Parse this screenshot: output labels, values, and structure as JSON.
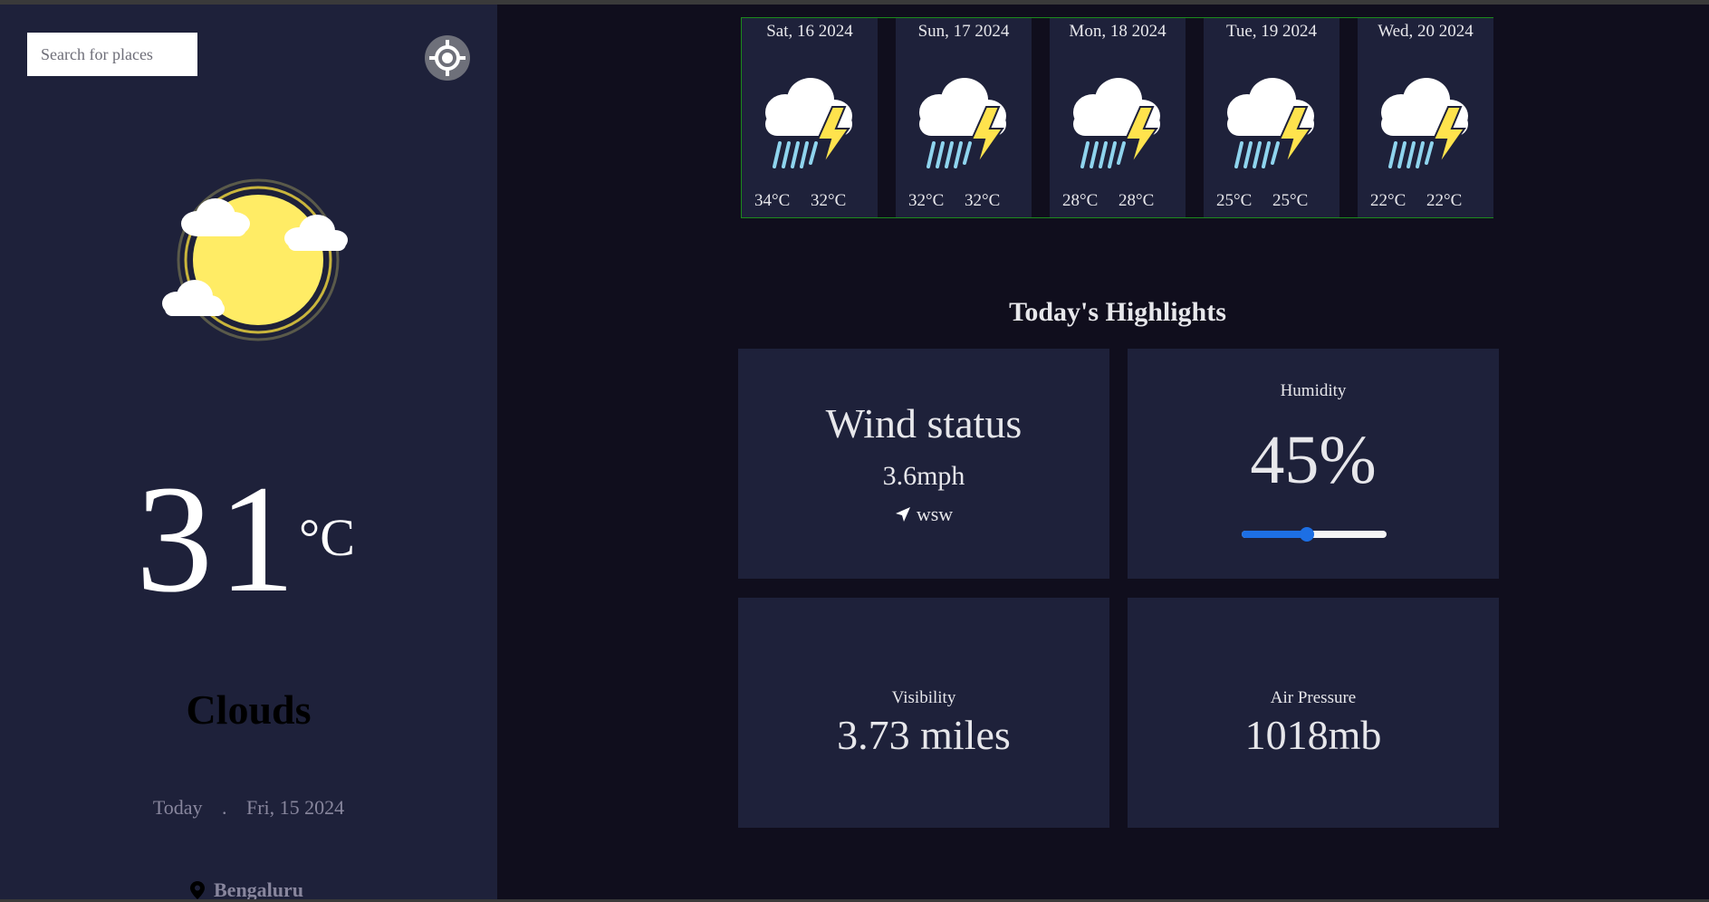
{
  "sidebar": {
    "search_placeholder": "Search for places",
    "locate_icon": "crosshair-gps-icon",
    "weather_icon": "sun-with-clouds-icon",
    "temperature": "31",
    "temperature_unit": "°C",
    "condition": "Clouds",
    "date_prefix": "Today",
    "date_separator": ".",
    "date": "Fri, 15 2024",
    "location_icon": "map-pin-icon",
    "location": "Bengaluru"
  },
  "forecast": [
    {
      "date": "Sat, 16 2024",
      "icon": "thunderstorm-rain-icon",
      "max": "34°C",
      "min": "32°C"
    },
    {
      "date": "Sun, 17 2024",
      "icon": "thunderstorm-rain-icon",
      "max": "32°C",
      "min": "32°C"
    },
    {
      "date": "Mon, 18 2024",
      "icon": "thunderstorm-rain-icon",
      "max": "28°C",
      "min": "28°C"
    },
    {
      "date": "Tue, 19 2024",
      "icon": "thunderstorm-rain-icon",
      "max": "25°C",
      "min": "25°C"
    },
    {
      "date": "Wed, 20 2024",
      "icon": "thunderstorm-rain-icon",
      "max": "22°C",
      "min": "22°C"
    }
  ],
  "highlights": {
    "title": "Today's Highlights",
    "wind": {
      "label": "Wind status",
      "value": "3.6mph",
      "direction": "wsw",
      "direction_icon": "navigation-arrow-icon"
    },
    "humidity": {
      "label": "Humidity",
      "value": "45%",
      "percent": 45
    },
    "visibility": {
      "label": "Visibility",
      "value": "3.73 miles"
    },
    "pressure": {
      "label": "Air Pressure",
      "value": "1018mb"
    }
  },
  "colors": {
    "background": "#100e1d",
    "panel": "#1e213a",
    "accent_blue": "#1d6fe4",
    "sun_yellow": "#ffec65",
    "bolt_yellow": "#ffe34d",
    "rain_blue": "#8fd4ee",
    "forecast_border": "#1c8a1c"
  }
}
